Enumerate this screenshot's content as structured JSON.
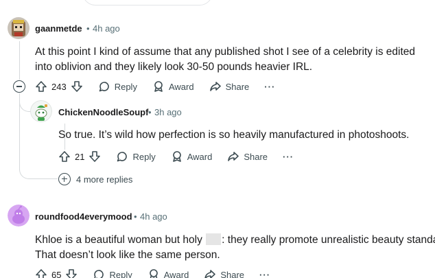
{
  "comments": [
    {
      "username": "gaanmetde",
      "separator": "•",
      "time": "4h ago",
      "text": "At this point I kind of assume that any published shot I see of a celebrity is edited into oblivion and they likely look 30-50 pounds heavier IRL.",
      "score": "243",
      "reply_label": "Reply",
      "award_label": "Award",
      "share_label": "Share",
      "more_label": "···"
    },
    {
      "username": "ChickenNoodleSoupf",
      "separator": "•",
      "time": "3h ago",
      "text": "So true. It’s wild how perfection is so heavily manufactured in photoshoots.",
      "score": "21",
      "reply_label": "Reply",
      "award_label": "Award",
      "share_label": "Share",
      "more_label": "···"
    },
    {
      "username": "roundfood4everymood",
      "separator": "•",
      "time": "4h ago",
      "text_before": "Khloe is a beautiful woman but holy",
      "text_after": ": they really promote unrealistic beauty standards.",
      "text_line2": "That doesn’t look like the same person.",
      "score": "65",
      "reply_label": "Reply",
      "award_label": "Award",
      "share_label": "Share",
      "more_label": "···"
    }
  ],
  "more_replies_label": "4 more replies",
  "colors": {
    "text": "#1a1a1b",
    "meta": "#576f76",
    "thread_line": "#d5d9db",
    "snoo_avatar_bg": "#d7a6f2"
  }
}
